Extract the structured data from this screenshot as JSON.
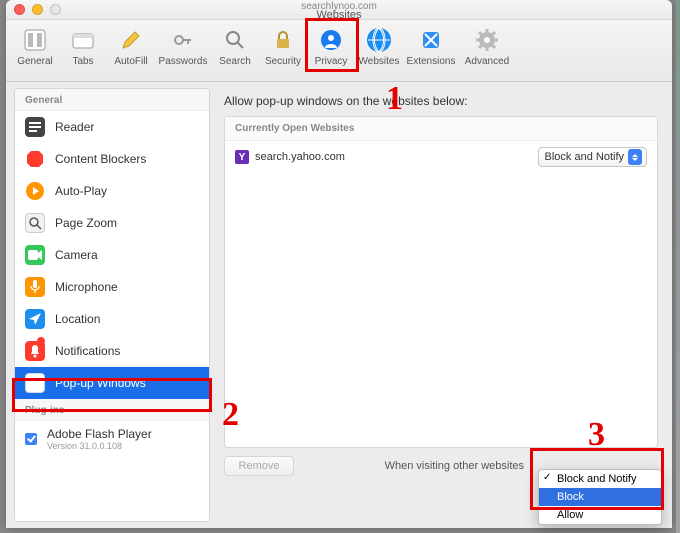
{
  "window": {
    "supertitle": "searchlynoo.com",
    "title": "Websites"
  },
  "toolbar": [
    {
      "id": "general",
      "label": "General"
    },
    {
      "id": "tabs",
      "label": "Tabs"
    },
    {
      "id": "autofill",
      "label": "AutoFill"
    },
    {
      "id": "passwords",
      "label": "Passwords"
    },
    {
      "id": "search",
      "label": "Search"
    },
    {
      "id": "security",
      "label": "Security"
    },
    {
      "id": "privacy",
      "label": "Privacy"
    },
    {
      "id": "websites",
      "label": "Websites"
    },
    {
      "id": "extensions",
      "label": "Extensions"
    },
    {
      "id": "advanced",
      "label": "Advanced"
    }
  ],
  "sidebar": {
    "sections": {
      "general": {
        "header": "General",
        "items": [
          {
            "id": "reader",
            "label": "Reader"
          },
          {
            "id": "content-blockers",
            "label": "Content Blockers"
          },
          {
            "id": "auto-play",
            "label": "Auto-Play"
          },
          {
            "id": "page-zoom",
            "label": "Page Zoom"
          },
          {
            "id": "camera",
            "label": "Camera"
          },
          {
            "id": "microphone",
            "label": "Microphone"
          },
          {
            "id": "location",
            "label": "Location"
          },
          {
            "id": "notifications",
            "label": "Notifications"
          },
          {
            "id": "popup-windows",
            "label": "Pop-up Windows",
            "selected": true
          }
        ]
      },
      "plugins": {
        "header": "Plug-ins",
        "items": [
          {
            "id": "flash",
            "label": "Adobe Flash Player",
            "sub": "Version 31.0.0.108",
            "checked": true
          }
        ]
      }
    }
  },
  "main": {
    "title": "Allow pop-up windows on the websites below:",
    "list_header": "Currently Open Websites",
    "rows": [
      {
        "site": "search.yahoo.com",
        "setting": "Block and Notify"
      }
    ],
    "remove_label": "Remove",
    "footer_label": "When visiting other websites",
    "dropdown": {
      "options": [
        "Block and Notify",
        "Block",
        "Allow"
      ],
      "checked": "Block and Notify",
      "highlighted": "Block"
    }
  },
  "annotations": {
    "n1": "1",
    "n2": "2",
    "n3": "3"
  }
}
